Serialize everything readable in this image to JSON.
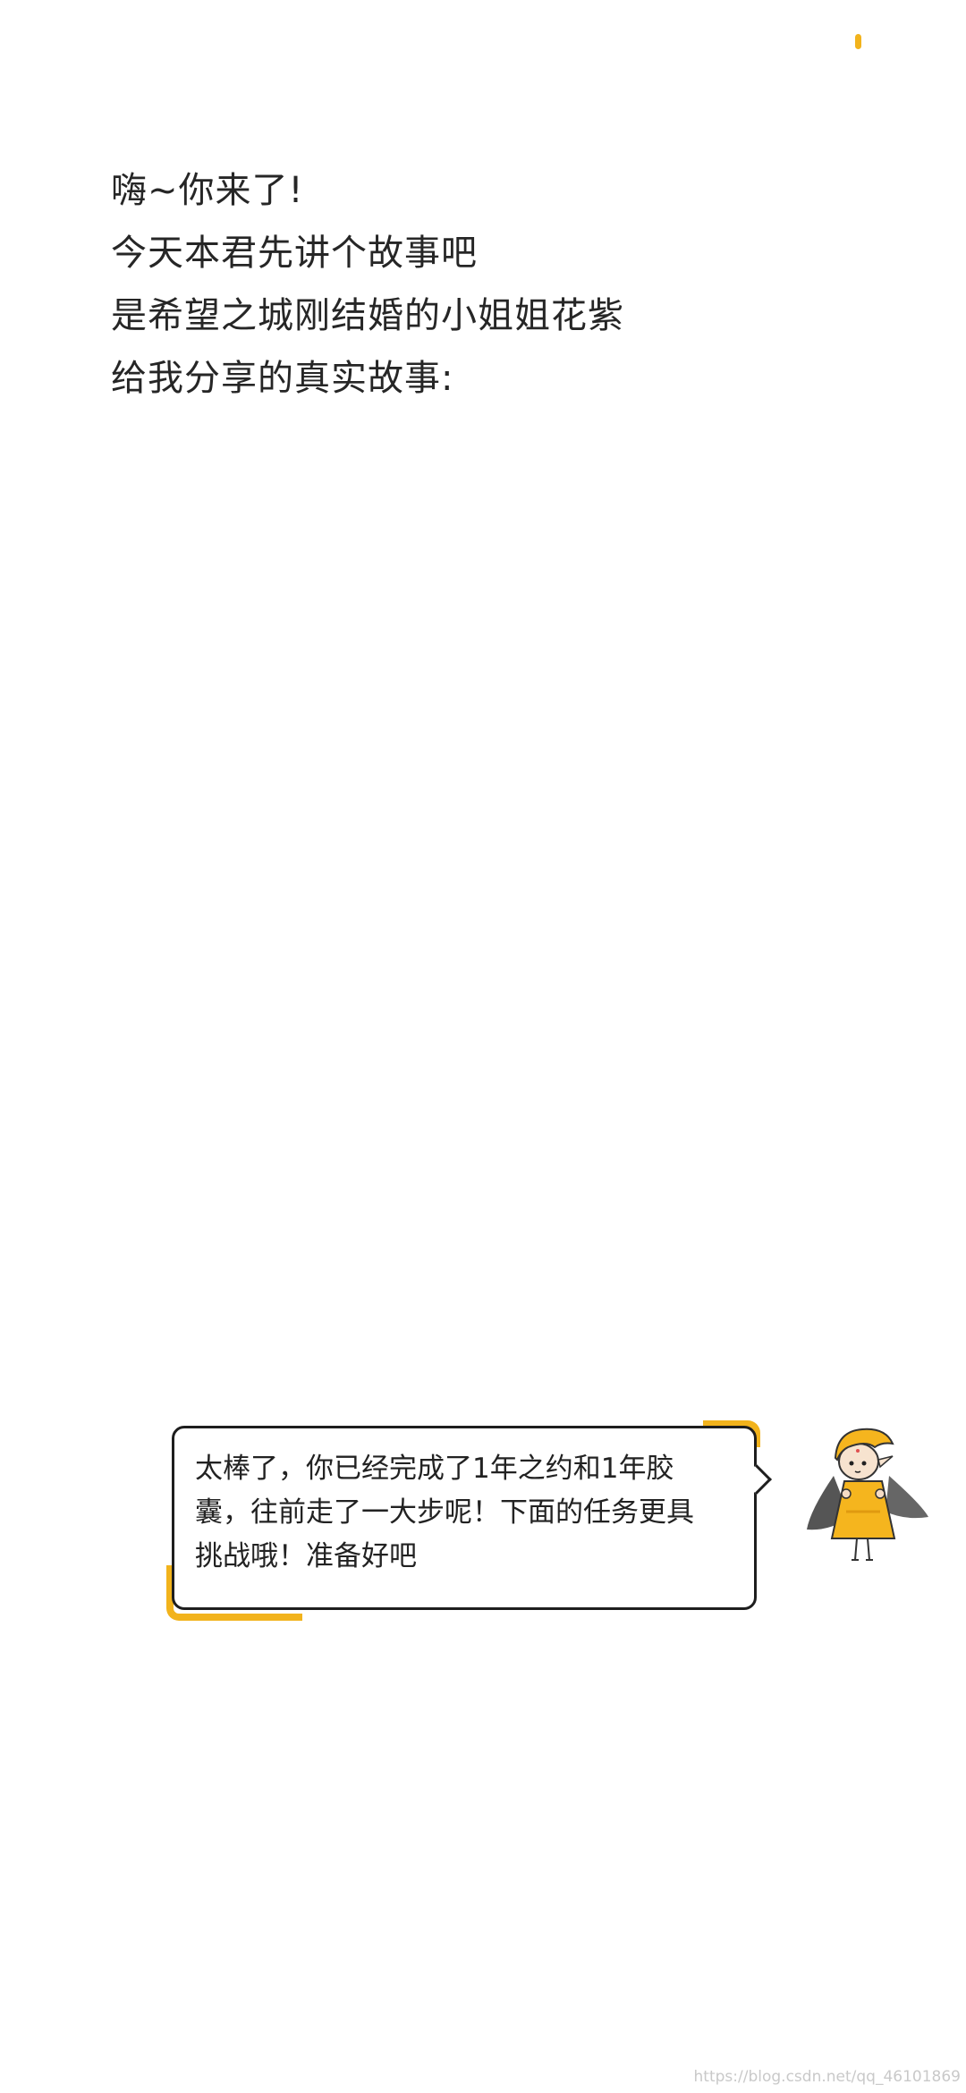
{
  "status": {
    "indicator_color": "#f2b31c"
  },
  "intro": {
    "lines": [
      "嗨~你来了!",
      "今天本君先讲个故事吧",
      "是希望之城刚结婚的小姐姐花紫",
      "给我分享的真实故事:"
    ]
  },
  "dialog": {
    "lines": [
      "太棒了，你已经完成了1年之约和1年胶",
      "囊，往前走了一大步呢！下面的任务更具",
      "挑战哦！准备好吧"
    ],
    "accent_color": "#f2b31c",
    "border_color": "#1e1e1e"
  },
  "mascot": {
    "icon": "cartoon-girl-yellow-hood-icon"
  },
  "watermark": {
    "text": "https://blog.csdn.net/qq_46101869"
  }
}
